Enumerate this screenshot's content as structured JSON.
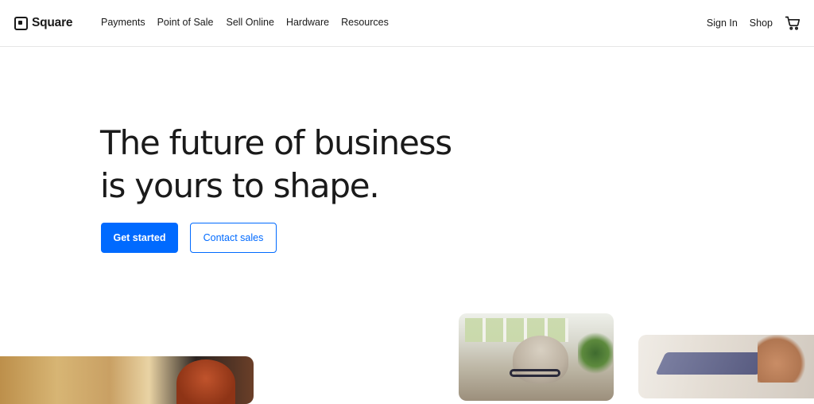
{
  "brand": {
    "name": "Square"
  },
  "nav": {
    "links": [
      "Payments",
      "Point of Sale",
      "Sell Online",
      "Hardware",
      "Resources"
    ],
    "sign_in": "Sign In",
    "shop": "Shop",
    "cart_icon": "cart-icon"
  },
  "hero": {
    "title_line1": "The future of business",
    "title_line2": "is yours to shape.",
    "primary_cta": "Get started",
    "secondary_cta": "Contact sales"
  },
  "colors": {
    "accent": "#006aff",
    "text": "#1a1a1a",
    "background": "#ffffff"
  }
}
